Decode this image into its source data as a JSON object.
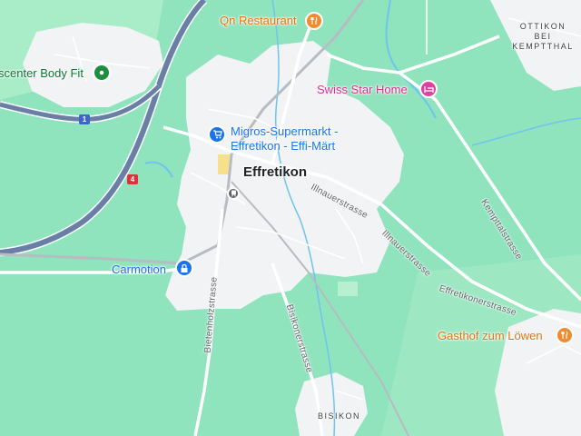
{
  "map": {
    "place": "Effretikon",
    "localities": [
      "OTTIKON BEI KEMPTTHAL",
      "BISIKON"
    ],
    "streets": [
      "Illnauerstrasse",
      "Kempttalstrasse",
      "Effretikonerstrasse",
      "Bietenholzstrasse",
      "Bisikonerstrasse"
    ],
    "road_shields": [
      "1",
      "4"
    ],
    "pois": [
      {
        "name": "Qn Restaurant",
        "category": "restaurant",
        "icon": "fork-knife-icon",
        "color": "#f28b30"
      },
      {
        "name": "Swiss Star Home",
        "category": "hotel",
        "icon": "bed-icon",
        "color": "#e040a0"
      },
      {
        "name": "Migros-Supermarkt - Effretikon - Effi-Märt",
        "line1": "Migros-Supermarkt -",
        "line2": "Effretikon - Effi-Märt",
        "category": "shop",
        "icon": "shopping-cart-icon",
        "color": "#1a73e8"
      },
      {
        "name": "Carmotion",
        "category": "car-dealer",
        "icon": "padlock-icon",
        "color": "#1a73e8"
      },
      {
        "name": "Gasthof zum Löwen",
        "category": "restaurant",
        "icon": "fork-knife-icon",
        "color": "#f28b30"
      },
      {
        "name": "scenter Body Fit",
        "category": "gym",
        "icon": "dumbbell-icon",
        "color": "#1e8e3e"
      }
    ],
    "colors": {
      "land": "#8fe3bd",
      "urban": "#f1f3f4",
      "motorway": "#6a7fa5",
      "water": "#6fc4ef"
    }
  }
}
